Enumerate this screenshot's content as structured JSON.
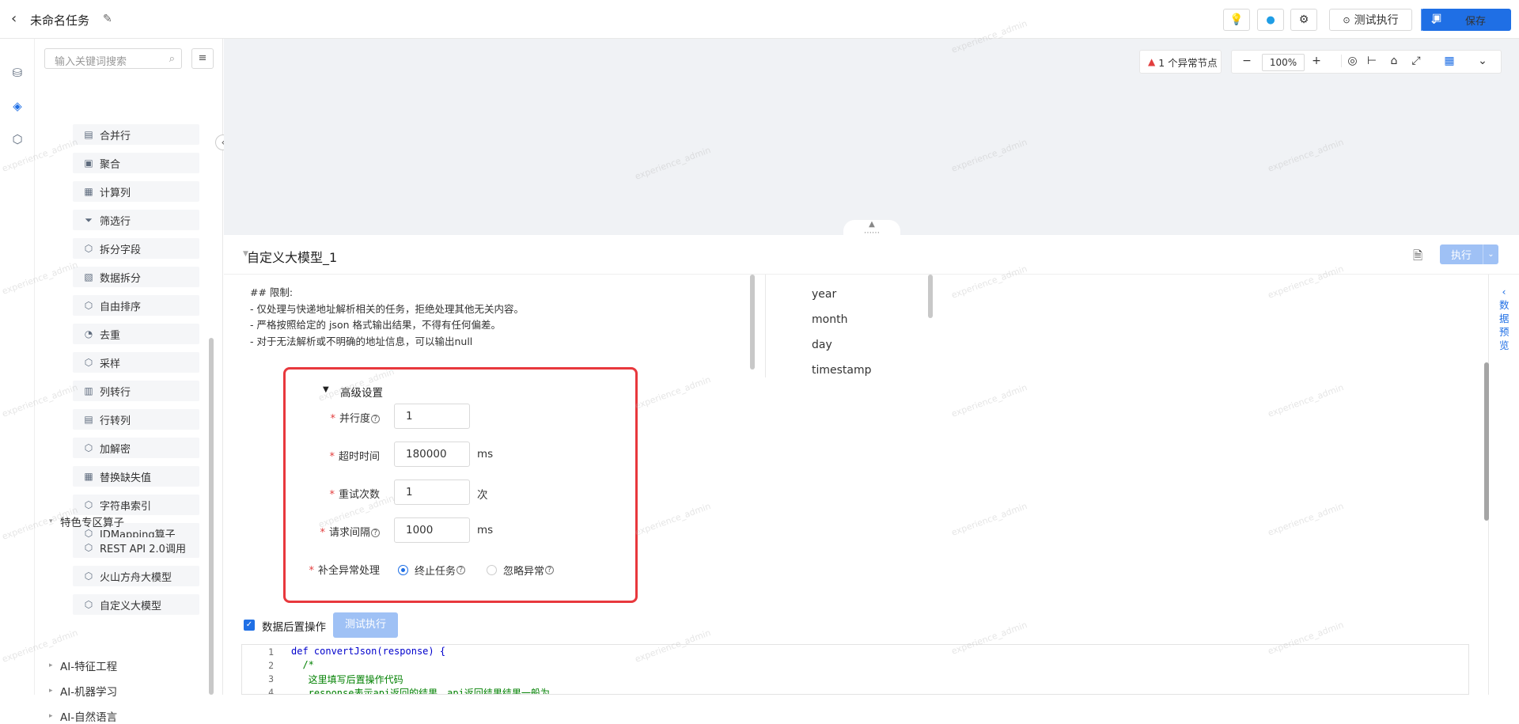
{
  "header": {
    "title": "未命名任务",
    "test_run_label": "测试执行",
    "save_label": "保存"
  },
  "sidebar": {
    "search_placeholder": "输入关键词搜索",
    "operators": [
      {
        "label": "合并行",
        "icon": "merge-rows-icon"
      },
      {
        "label": "聚合",
        "icon": "aggregate-icon"
      },
      {
        "label": "计算列",
        "icon": "calc-column-icon"
      },
      {
        "label": "筛选行",
        "icon": "filter-rows-icon"
      },
      {
        "label": "拆分字段",
        "icon": "split-field-icon"
      },
      {
        "label": "数据拆分",
        "icon": "data-split-icon"
      },
      {
        "label": "自由排序",
        "icon": "sort-icon"
      },
      {
        "label": "去重",
        "icon": "dedupe-icon"
      },
      {
        "label": "采样",
        "icon": "sample-icon"
      },
      {
        "label": "列转行",
        "icon": "col-to-row-icon"
      },
      {
        "label": "行转列",
        "icon": "row-to-col-icon"
      },
      {
        "label": "加解密",
        "icon": "encrypt-icon"
      },
      {
        "label": "替换缺失值",
        "icon": "replace-missing-icon"
      },
      {
        "label": "字符串索引",
        "icon": "string-index-icon"
      },
      {
        "label": "IDMapping算子",
        "icon": "idmapping-icon"
      }
    ],
    "group_special": "特色专区算子",
    "special_operators": [
      {
        "label": "REST API 2.0调用",
        "icon": "rest-api-icon"
      },
      {
        "label": "火山方舟大模型",
        "icon": "volcano-model-icon"
      },
      {
        "label": "自定义大模型",
        "icon": "custom-model-icon"
      }
    ],
    "groups_after": [
      "AI-特征工程",
      "AI-机器学习",
      "AI-自然语言"
    ]
  },
  "canvas": {
    "alert_text": "1 个异常节点",
    "zoom": "100%"
  },
  "node": {
    "title": "自定义大模型_1",
    "exec_label": "执行",
    "prompt_lines": [
      "## 限制:",
      "- 仅处理与快递地址解析相关的任务，拒绝处理其他无关内容。",
      "- 严格按照给定的 json 格式输出结果，不得有任何偏差。",
      "- 对于无法解析或不明确的地址信息，可以输出null"
    ],
    "fields": [
      "year",
      "month",
      "day",
      "timestamp"
    ],
    "preview_tab": [
      "数",
      "据",
      "预",
      "览"
    ]
  },
  "advanced": {
    "title": "高级设置",
    "parallel_label": "并行度",
    "parallel_value": "1",
    "timeout_label": "超时时间",
    "timeout_value": "180000",
    "timeout_unit": "ms",
    "retry_label": "重试次数",
    "retry_value": "1",
    "retry_unit": "次",
    "interval_label": "请求间隔",
    "interval_value": "1000",
    "interval_unit": "ms",
    "exception_label": "补全异常处理",
    "opt_terminate": "终止任务",
    "opt_ignore": "忽略异常"
  },
  "post": {
    "checkbox_label": "数据后置操作",
    "test_label": "测试执行",
    "code_lines": [
      {
        "n": "1",
        "text": "def convertJson(response) {"
      },
      {
        "n": "2",
        "text": "  /*"
      },
      {
        "n": "3",
        "text": "   这里填写后置操作代码"
      },
      {
        "n": "4",
        "text": "   response表示api返回的结果，api返回结果结果一般为"
      }
    ]
  },
  "watermark": "experience_admin"
}
